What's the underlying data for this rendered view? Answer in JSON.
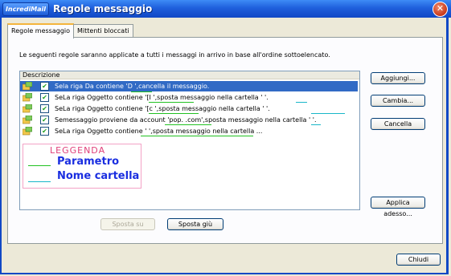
{
  "window": {
    "logo": "IncrediMail",
    "title": "Regole messaggio",
    "close_glyph": "✕"
  },
  "tabs": [
    {
      "label": "Regole messaggio",
      "active": true
    },
    {
      "label": "Mittenti bloccati",
      "active": false
    }
  ],
  "intro": "Le seguenti regole saranno applicate a tutti i messaggi in arrivo in base all'ordine sottoelencato.",
  "list": {
    "column_header": "Descrizione",
    "rows": [
      {
        "icon": "rule-icon",
        "checked": true,
        "selected": true,
        "text": "Sela riga Da contiene 'D               ',cancella il messaggio."
      },
      {
        "icon": "rule-icon",
        "checked": true,
        "selected": false,
        "text": "SeLa riga Oggetto contiene '[I                          ',sposta messaggio nella cartella '    '."
      },
      {
        "icon": "rule-icon",
        "checked": true,
        "selected": false,
        "text": "SeLa riga Oggetto contiene '[c                           ',sposta messaggio nella cartella '             '."
      },
      {
        "icon": "rule-icon",
        "checked": true,
        "selected": false,
        "text": "Semessaggio proviene da account 'pop.         .com',sposta messaggio nella cartella '    '."
      },
      {
        "icon": "rule-icon",
        "checked": true,
        "selected": false,
        "text": "SeLa riga Oggetto contiene '                                                 ',sposta messaggio nella cartella ..."
      }
    ]
  },
  "legend": {
    "title": "LEGGENDA",
    "items": [
      {
        "label": "Parametro",
        "color": "#22c122"
      },
      {
        "label": "Nome cartella",
        "color": "#19b7c9"
      }
    ]
  },
  "buttons": {
    "add": "Aggiungi...",
    "change": "Cambia...",
    "delete": "Cancella",
    "apply": "Applica adesso...",
    "move_up": "Sposta su",
    "move_down": "Sposta giù",
    "close": "Chiudi"
  },
  "colors": {
    "titlebar": "#1f5fdc",
    "selection": "#316AC5",
    "dialog_bg": "#ECE9D8"
  }
}
